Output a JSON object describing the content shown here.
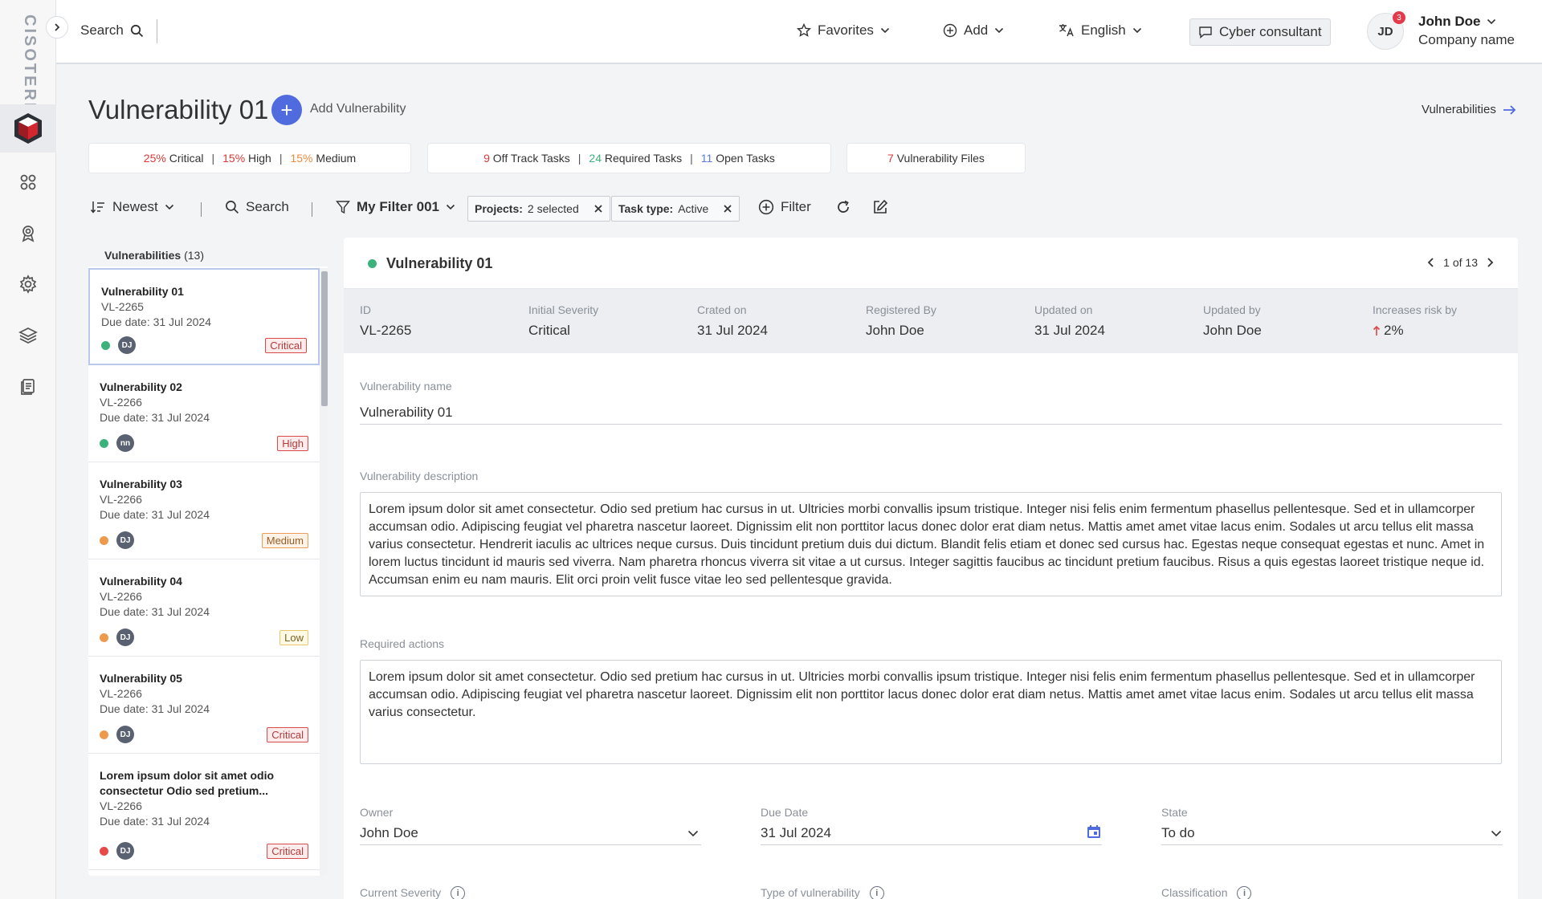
{
  "brand": {
    "name": "CISOTERIA"
  },
  "topbar": {
    "search_label": "Search",
    "favorites_label": "Favorites",
    "add_label": "Add",
    "language_label": "English",
    "consultant_label": "Cyber consultant",
    "user_initials": "JD",
    "notification_count": "3",
    "user_name": "John Doe",
    "company_name": "Company name"
  },
  "header": {
    "title": "Vulnerability 01",
    "add_vulnerability_label": "Add Vulnerability",
    "vulnerabilities_link": "Vulnerabilities"
  },
  "stats": {
    "critical_pct": "25%",
    "critical_label": "Critical",
    "high_pct": "15%",
    "high_label": "High",
    "medium_pct": "15%",
    "medium_label": "Medium",
    "offtrack_count": "9",
    "offtrack_label": "Off Track Tasks",
    "required_count": "24",
    "required_label": "Required Tasks",
    "open_count": "11",
    "open_label": "Open Tasks",
    "files_count": "7",
    "files_label": "Vulnerability Files"
  },
  "filterbar": {
    "sort_label": "Newest",
    "search_label": "Search",
    "filter_name": "My Filter 001",
    "chip_projects_key": "Projects:",
    "chip_projects_val": "2 selected",
    "chip_task_key": "Task type:",
    "chip_task_val": "Active",
    "filter_label": "Filter"
  },
  "list": {
    "header_label": "Vulnerabilities",
    "header_count": "(13)",
    "items": [
      {
        "title": "Vulnerability 01",
        "id": "VL-2265",
        "due": "Due date: 31 Jul 2024",
        "status_color": "#3bb27b",
        "initials": "DJ",
        "severity": "Critical"
      },
      {
        "title": "Vulnerability 02",
        "id": "VL-2266",
        "due": "Due date: 31 Jul 2024",
        "status_color": "#3bb27b",
        "initials": "nn",
        "severity": "High"
      },
      {
        "title": "Vulnerability 03",
        "id": "VL-2266",
        "due": "Due date: 31 Jul 2024",
        "status_color": "#ee9a4d",
        "initials": "DJ",
        "severity": "Medium"
      },
      {
        "title": "Vulnerability 04",
        "id": "VL-2266",
        "due": "Due date: 31 Jul 2024",
        "status_color": "#ee9a4d",
        "initials": "DJ",
        "severity": "Low"
      },
      {
        "title": "Vulnerability 05",
        "id": "VL-2266",
        "due": "Due date: 31 Jul 2024",
        "status_color": "#ee9a4d",
        "initials": "DJ",
        "severity": "Critical"
      },
      {
        "title": "Lorem ipsum dolor sit amet odio consectetur Odio sed pretium...",
        "id": "VL-2266",
        "due": "Due date: 31 Jul 2024",
        "status_color": "#e84a4a",
        "initials": "DJ",
        "severity": "Critical"
      }
    ]
  },
  "detail": {
    "status_color": "#3bb27b",
    "title": "Vulnerability 01",
    "pager": "1 of 13",
    "meta": {
      "id_label": "ID",
      "id_val": "VL-2265",
      "severity_label": "Initial Severity",
      "severity_val": "Critical",
      "created_label": "Crated on",
      "created_val": "31 Jul 2024",
      "registered_label": "Registered By",
      "registered_val": "John Doe",
      "updated_label": "Updated on",
      "updated_val": "31 Jul 2024",
      "updatedby_label": "Updated by",
      "updatedby_val": "John Doe",
      "risk_label": "Increases risk by",
      "risk_val": "2%"
    },
    "name_label": "Vulnerability name",
    "name_val": "Vulnerability 01",
    "desc_label": "Vulnerability description",
    "desc_val": "Lorem ipsum dolor sit amet consectetur. Odio sed pretium hac cursus in ut. Ultricies morbi convallis ipsum tristique. Integer nisi felis enim fermentum phasellus pellentesque. Sed et in ullamcorper accumsan odio. Adipiscing feugiat vel pharetra nascetur laoreet. Dignissim elit non porttitor lacus donec dolor erat diam netus. Mattis amet amet vitae lacus enim. Sodales ut arcu tellus elit massa varius consectetur. Hendrerit iaculis ac ultrices neque cursus. Duis tincidunt pretium duis dui dictum. Blandit felis etiam et donec sed cursus hac. Egestas neque consequat egestas et nunc. Amet in lorem luctus tincidunt id mauris sed viverra. Nam pharetra rhoncus viverra sit vitae a ut cursus. Integer sagittis faucibus ac tincidunt pretium faucibus. Risus a quis egestas laoreet tristique neque id. Accumsan enim eu nam mauris. Elit orci proin velit fusce vitae leo sed pellentesque gravida.",
    "actions_label": "Required actions",
    "actions_val": "Lorem ipsum dolor sit amet consectetur. Odio sed pretium hac cursus in ut. Ultricies morbi convallis ipsum tristique. Integer nisi felis enim fermentum phasellus pellentesque. Sed et in ullamcorper accumsan odio. Adipiscing feugiat vel pharetra nascetur laoreet. Dignissim elit non porttitor lacus donec dolor erat diam netus. Mattis amet amet vitae lacus enim. Sodales ut arcu tellus elit massa varius consectetur.",
    "owner_label": "Owner",
    "owner_val": "John Doe",
    "due_label": "Due Date",
    "due_val": "31 Jul 2024",
    "state_label": "State",
    "state_val": "To do",
    "current_severity_label": "Current Severity",
    "type_label": "Type of vulnerability",
    "classification_label": "Classification"
  },
  "colors": {
    "accent": "#4f6bde",
    "critical": "#d93a3a",
    "high": "#ee8a3e",
    "green": "#3bb27b"
  }
}
